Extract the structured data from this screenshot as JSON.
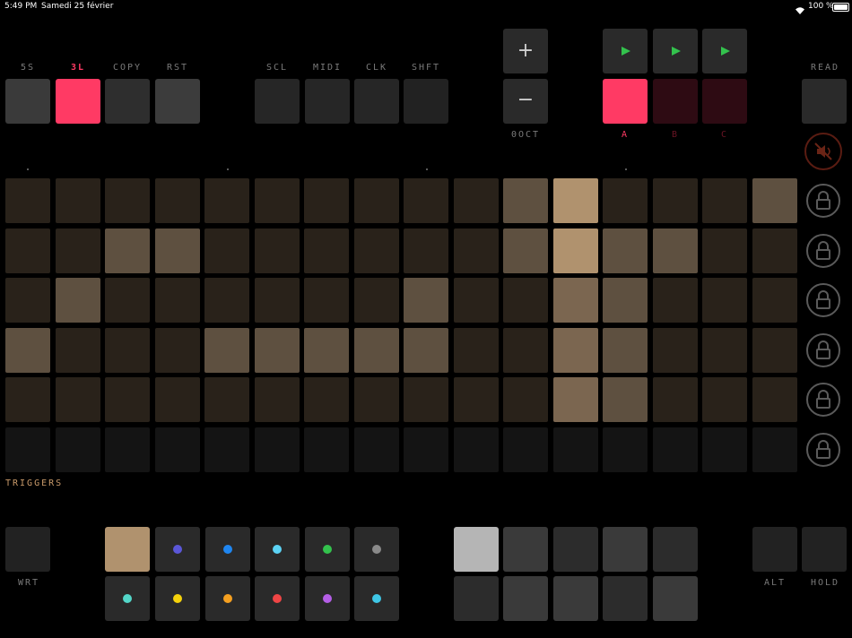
{
  "status_bar": {
    "time": "5:49 PM",
    "date": "Samedi 25 février",
    "battery": "100 %"
  },
  "top_buttons": [
    {
      "label": "5S",
      "color": "#3a3a3a",
      "label_color": "#7a7a7a"
    },
    {
      "label": "3L",
      "color": "#ff3a64",
      "label_color": "#ff3a64"
    },
    {
      "label": "COPY",
      "color": "#2e2e2e",
      "label_color": "#7a7a7a"
    },
    {
      "label": "RST",
      "color": "#3c3c3c",
      "label_color": "#7a7a7a"
    },
    {
      "label": "SCL",
      "color": "#262626",
      "label_color": "#7a7a7a"
    },
    {
      "label": "MIDI",
      "color": "#262626",
      "label_color": "#7a7a7a"
    },
    {
      "label": "CLK",
      "color": "#262626",
      "label_color": "#7a7a7a"
    },
    {
      "label": "SHFT",
      "color": "#222222",
      "label_color": "#7a7a7a"
    }
  ],
  "octave": {
    "plus": "+",
    "minus": "−",
    "label": "0OCT"
  },
  "patterns": [
    {
      "label": "A",
      "color": "#ff3a64",
      "label_color": "#ff3a64"
    },
    {
      "label": "B",
      "color": "#2e0b13",
      "label_color": "#6a1424"
    },
    {
      "label": "C",
      "color": "#2e0b13",
      "label_color": "#6a1424"
    }
  ],
  "play_icon_color": "#33c24d",
  "read": {
    "label": "READ"
  },
  "grid": {
    "rows": [
      [
        1,
        1,
        1,
        1,
        1,
        1,
        1,
        1,
        1,
        1,
        4,
        7,
        1,
        1,
        1,
        4
      ],
      [
        1,
        1,
        4,
        4,
        1,
        1,
        1,
        1,
        1,
        1,
        4,
        7,
        4,
        4,
        1,
        1
      ],
      [
        1,
        4,
        1,
        1,
        1,
        1,
        1,
        1,
        4,
        1,
        1,
        5,
        4,
        1,
        1,
        1
      ],
      [
        4,
        1,
        1,
        1,
        4,
        4,
        4,
        4,
        4,
        1,
        1,
        5,
        4,
        1,
        1,
        1
      ],
      [
        1,
        1,
        1,
        1,
        1,
        1,
        1,
        1,
        1,
        1,
        1,
        5,
        4,
        1,
        1,
        1
      ],
      [
        0,
        0,
        0,
        0,
        0,
        0,
        0,
        0,
        0,
        0,
        0,
        0,
        0,
        0,
        0,
        0
      ]
    ],
    "palette": {
      "0": "#141414",
      "1": "#29221a",
      "4": "#5e5040",
      "5": "#7b6650",
      "7": "#b0926e"
    }
  },
  "triggers_label": "TRIGGERS",
  "bottom": {
    "wrt": "WRT",
    "alt": "ALT",
    "hold": "HOLD",
    "swatch_color": "#b0926e",
    "dots_row1": [
      "#5b57d8",
      "#1f86f0",
      "#5cd3f4",
      "#33c24d",
      "#8a8a8a"
    ],
    "dots_row2": [
      "#53d6c8",
      "#f5d20b",
      "#f5a020",
      "#ef4545",
      "#b45ee6",
      "#3fc7e6"
    ],
    "right_block_row1": [
      "#b5b5b5",
      "#3a3a3a",
      "#2c2c2c",
      "#3a3a3a",
      "#2c2c2c"
    ],
    "right_block_row2": [
      "#2c2c2c",
      "#3a3a3a",
      "#3a3a3a",
      "#2c2c2c",
      "#3a3a3a"
    ]
  }
}
